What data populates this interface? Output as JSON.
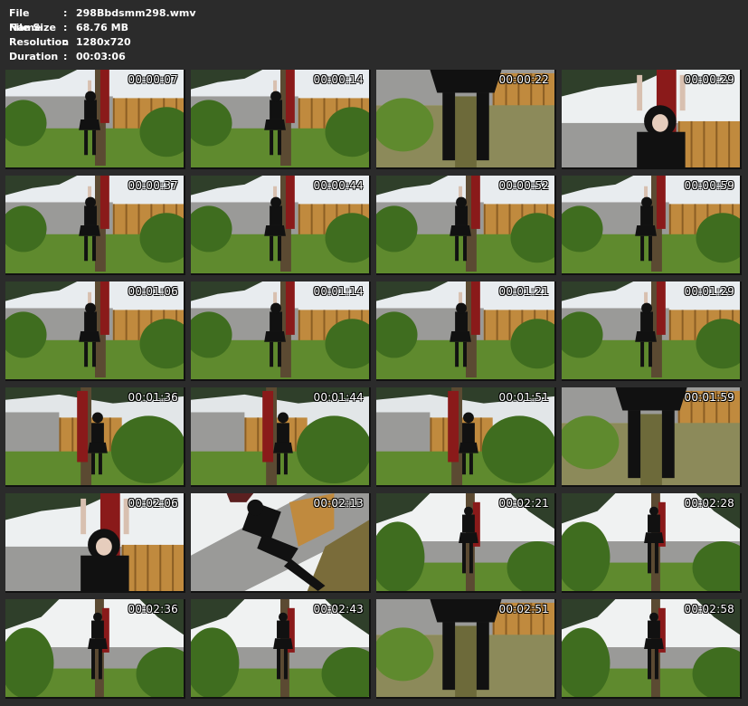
{
  "file_info": [
    {
      "label": "File Name",
      "value": "298Bbdsmm298.wmv"
    },
    {
      "label": "File Size",
      "value": "68.76 MB"
    },
    {
      "label": "Resolution",
      "value": "1280x720"
    },
    {
      "label": "Duration",
      "value": "00:03:06"
    }
  ],
  "separator": ":",
  "thumbnails": [
    {
      "time": "00:00:07",
      "scene": "wide"
    },
    {
      "time": "00:00:14",
      "scene": "wide"
    },
    {
      "time": "00:00:22",
      "scene": "legs"
    },
    {
      "time": "00:00:29",
      "scene": "closeup"
    },
    {
      "time": "00:00:37",
      "scene": "wide"
    },
    {
      "time": "00:00:44",
      "scene": "wide"
    },
    {
      "time": "00:00:52",
      "scene": "wide"
    },
    {
      "time": "00:00:59",
      "scene": "wide"
    },
    {
      "time": "00:01:06",
      "scene": "wide"
    },
    {
      "time": "00:01:14",
      "scene": "wide"
    },
    {
      "time": "00:01:21",
      "scene": "wide"
    },
    {
      "time": "00:01:29",
      "scene": "wide"
    },
    {
      "time": "00:01:36",
      "scene": "side"
    },
    {
      "time": "00:01:44",
      "scene": "side"
    },
    {
      "time": "00:01:51",
      "scene": "side"
    },
    {
      "time": "00:01:59",
      "scene": "legs"
    },
    {
      "time": "00:02:06",
      "scene": "closeup"
    },
    {
      "time": "00:02:13",
      "scene": "tilted"
    },
    {
      "time": "00:02:21",
      "scene": "low"
    },
    {
      "time": "00:02:28",
      "scene": "low"
    },
    {
      "time": "00:02:36",
      "scene": "low"
    },
    {
      "time": "00:02:43",
      "scene": "low"
    },
    {
      "time": "00:02:51",
      "scene": "legs"
    },
    {
      "time": "00:02:58",
      "scene": "low"
    }
  ],
  "colors": {
    "background": "#2b2b2b",
    "sky": "#e8ecef",
    "wall": "#9a9a98",
    "fence": "#c08a3e",
    "grass": "#5f8a2e",
    "foliage": "#3f6d1f",
    "figure": "#111111",
    "scarf": "#8a1a1a"
  }
}
